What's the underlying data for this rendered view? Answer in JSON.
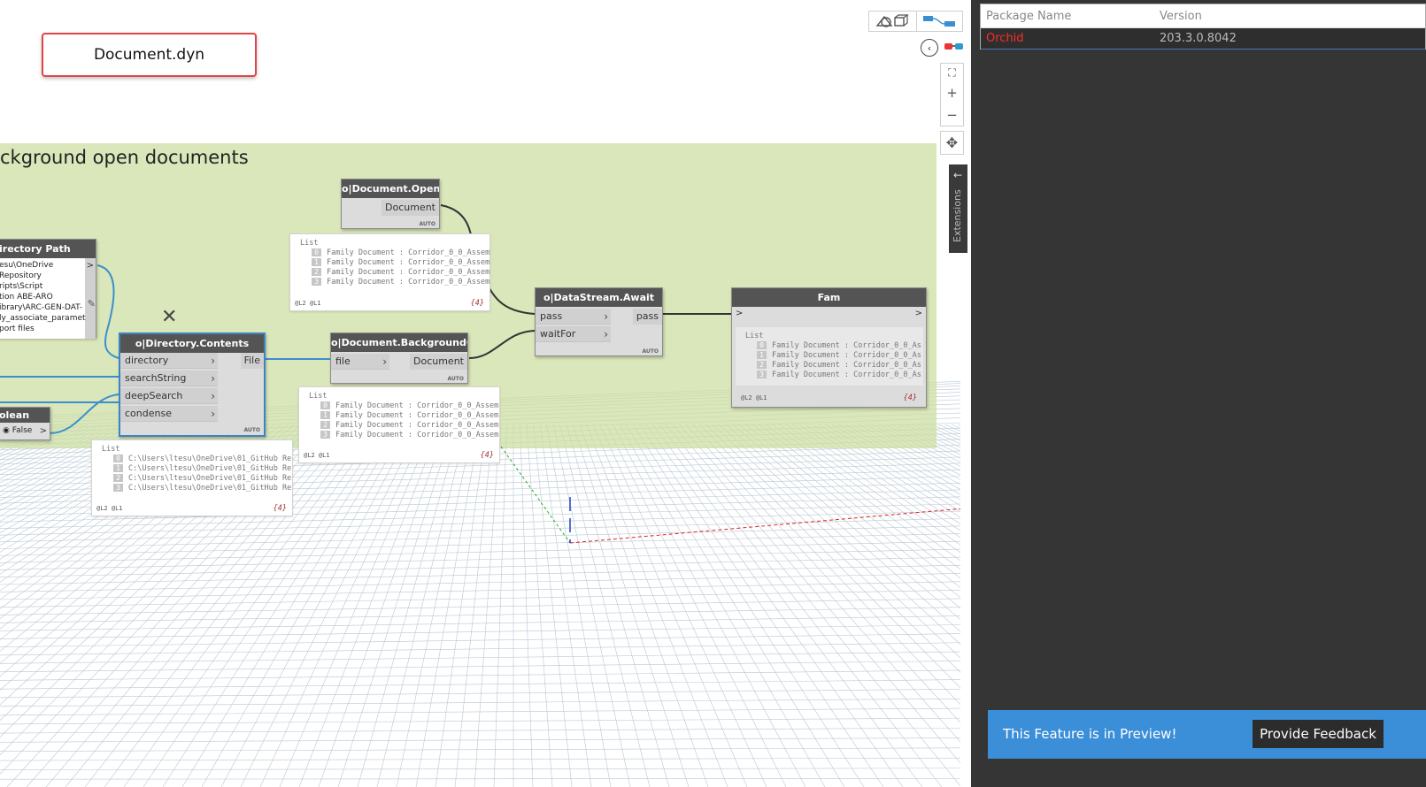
{
  "workspace": {
    "file_tab": "Document.dyn",
    "group_title": "ckground open documents"
  },
  "nodes": {
    "directory_path": {
      "title": "irectory Path",
      "lines": [
        "esu\\OneDrive",
        " Repository",
        "ripts\\Script",
        "tion ABE-ARO",
        "ibrary\\ARC-GEN-DAT-",
        "ly_associate_paramet",
        "port files"
      ]
    },
    "boolean": {
      "title": "olean",
      "value": "False"
    },
    "directory_contents": {
      "title": "o|Directory.Contents",
      "inputs": [
        "directory",
        "searchString",
        "deepSearch",
        "condense"
      ],
      "output": "File",
      "lacing": "AUTO"
    },
    "document_opened": {
      "title": "o|Document.Opened",
      "output": "Document",
      "lacing": "AUTO"
    },
    "document_background_open": {
      "title": "o|Document.BackgroundOpen",
      "input": "file",
      "output": "Document",
      "lacing": "AUTO"
    },
    "datastream_await": {
      "title": "o|DataStream.Await",
      "inputs": [
        "pass",
        "waitFor"
      ],
      "output": "pass",
      "lacing": "AUTO"
    },
    "fam": {
      "title": "Fam",
      "in_port": ">",
      "out_port": ">"
    }
  },
  "previews": {
    "dir_contents": {
      "title": "List",
      "rows": [
        {
          "index": "0",
          "text": "C:\\Users\\ltesu\\OneDrive\\01_GitHub Rep"
        },
        {
          "index": "1",
          "text": "C:\\Users\\ltesu\\OneDrive\\01_GitHub Rep"
        },
        {
          "index": "2",
          "text": "C:\\Users\\ltesu\\OneDrive\\01_GitHub Rep"
        },
        {
          "index": "3",
          "text": "C:\\Users\\ltesu\\OneDrive\\01_GitHub Rep"
        }
      ],
      "levels": "@L2 @L1",
      "count": "{4}"
    },
    "doc_opened": {
      "title": "List",
      "rows": [
        {
          "index": "0",
          "text": "Family Document : Corridor_0_0_Assem"
        },
        {
          "index": "1",
          "text": "Family Document : Corridor_0_0_Assem"
        },
        {
          "index": "2",
          "text": "Family Document : Corridor_0_0_Assem"
        },
        {
          "index": "3",
          "text": "Family Document : Corridor_0_0_Assem"
        }
      ],
      "levels": "@L2 @L1",
      "count": "{4}"
    },
    "background_open": {
      "title": "List",
      "rows": [
        {
          "index": "0",
          "text": "Family Document : Corridor_0_0_Assem"
        },
        {
          "index": "1",
          "text": "Family Document : Corridor_0_0_Assem"
        },
        {
          "index": "2",
          "text": "Family Document : Corridor_0_0_Assem"
        },
        {
          "index": "3",
          "text": "Family Document : Corridor_0_0_Assem"
        }
      ],
      "levels": "@L2 @L1",
      "count": "{4}"
    },
    "fam": {
      "title": "List",
      "rows": [
        {
          "index": "0",
          "text": "Family Document : Corridor_0_0_As"
        },
        {
          "index": "1",
          "text": "Family Document : Corridor_0_0_As"
        },
        {
          "index": "2",
          "text": "Family Document : Corridor_0_0_As"
        },
        {
          "index": "3",
          "text": "Family Document : Corridor_0_0_As"
        }
      ],
      "levels": "@L2 @L1",
      "count": "{4}"
    }
  },
  "toolbar": {
    "extensions_label": "Extensions",
    "zoom_fit_icon": "⛶",
    "zoom_in_icon": "+",
    "zoom_out_icon": "−",
    "pan_icon": "✥",
    "collapse_icon": "‹"
  },
  "side_panel": {
    "columns": [
      "Package Name",
      "Version"
    ],
    "packages": [
      {
        "name": "Orchid",
        "version": "203.3.0.8042"
      }
    ],
    "preview_message": "This Feature is in Preview!",
    "feedback_button": "Provide Feedback"
  },
  "colors": {
    "group_background": "#ccdea0",
    "node_header": "#545454",
    "selected_border": "#3c84c4",
    "wire_dark": "#333333",
    "wire_blue": "#3c8fcf",
    "package_name_text": "#ff2a2a",
    "preview_bar": "#3b8ed8",
    "side_panel": "#353535"
  }
}
